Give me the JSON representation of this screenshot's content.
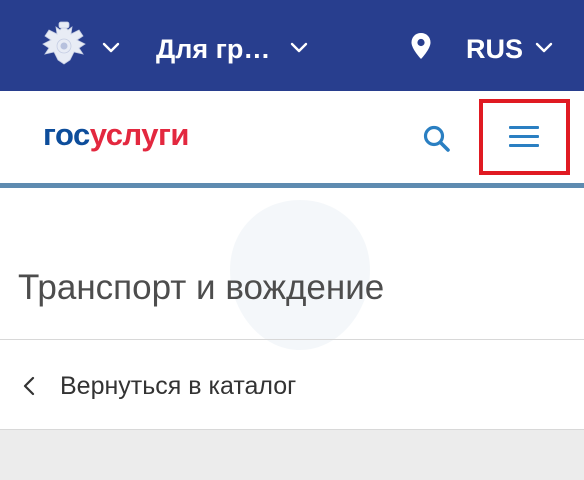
{
  "topbar": {
    "emblem_icon": "coat-of-arms-icon",
    "audience_label": "Для гр…",
    "location_icon": "map-pin-icon",
    "language_label": "RUS",
    "background_color": "#283e8e"
  },
  "header": {
    "logo_part1": "гос",
    "logo_part2": "услуги",
    "logo_colors": {
      "part1": "#0d4d9b",
      "part2": "#e3283f"
    },
    "search_icon": "search-icon",
    "menu_icon": "hamburger-menu-icon",
    "highlight_color": "#e01a22"
  },
  "main": {
    "title": "Транспорт и вождение",
    "back_link_label": "Вернуться в каталог"
  }
}
